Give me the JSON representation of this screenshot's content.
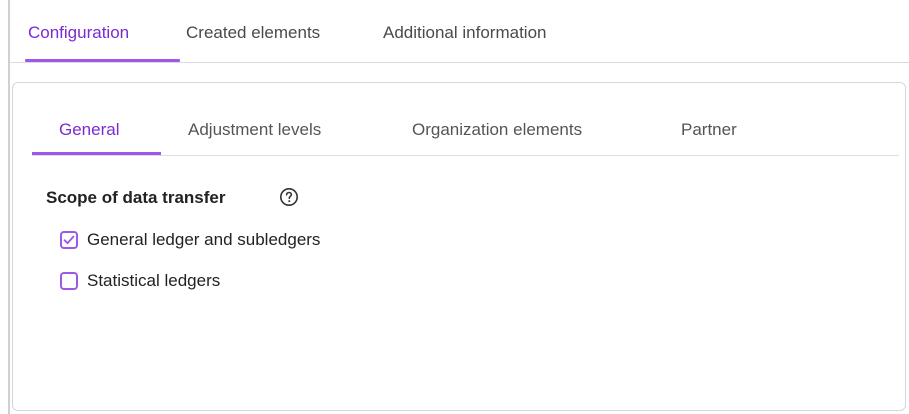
{
  "top_tabs": [
    {
      "label": "Configuration",
      "active": true
    },
    {
      "label": "Created elements",
      "active": false
    },
    {
      "label": "Additional information",
      "active": false
    }
  ],
  "inner_tabs": [
    {
      "label": "General",
      "active": true
    },
    {
      "label": "Adjustment levels",
      "active": false
    },
    {
      "label": "Organization elements",
      "active": false
    },
    {
      "label": "Partner",
      "active": false
    }
  ],
  "scope": {
    "title": "Scope of data transfer",
    "help_icon": "question-circle-icon",
    "options": [
      {
        "label": "General ledger and subledgers",
        "checked": true
      },
      {
        "label": "Statistical ledgers",
        "checked": false
      }
    ]
  },
  "colors": {
    "accent": "#7b2ad1",
    "accent_light": "#9b59e6",
    "border": "#d6d6dc",
    "text": "#222222"
  }
}
